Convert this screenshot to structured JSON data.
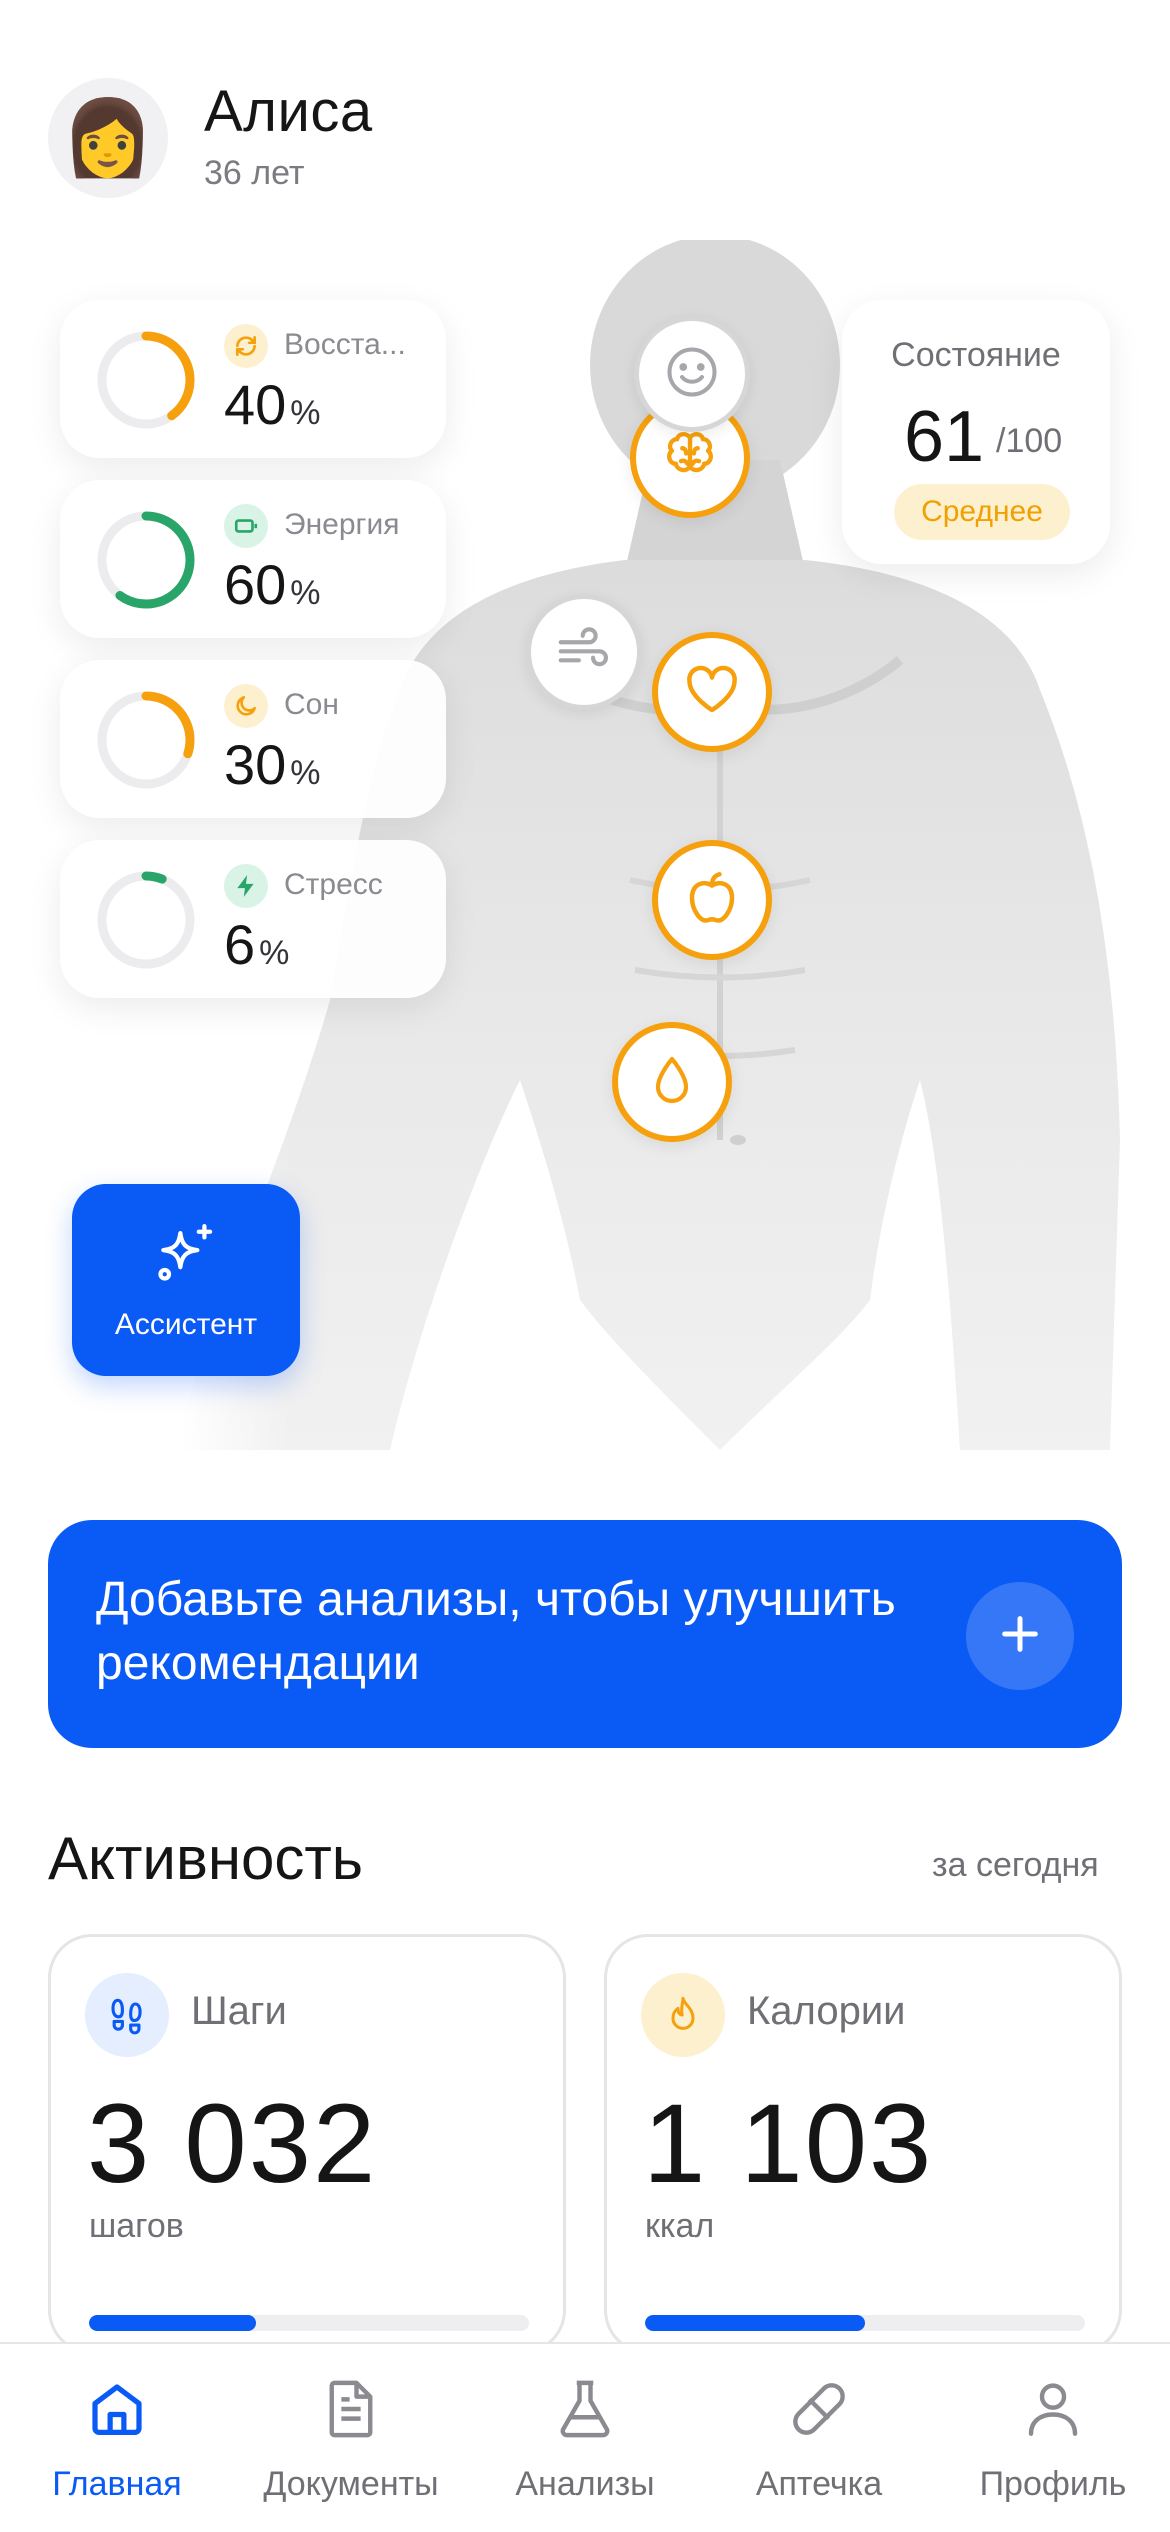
{
  "user": {
    "avatar_emoji": "👩",
    "name": "Алиса",
    "age": "36 лет"
  },
  "metrics": [
    {
      "label": "Восста...",
      "value": "40",
      "unit": "%",
      "progress": 0.4,
      "color": "#f5a00c",
      "icon": "refresh-icon"
    },
    {
      "label": "Энергия",
      "value": "60",
      "unit": "%",
      "progress": 0.6,
      "color": "#2aa56a",
      "icon": "battery-icon"
    },
    {
      "label": "Сон",
      "value": "30",
      "unit": "%",
      "progress": 0.3,
      "color": "#f5a00c",
      "icon": "moon-icon"
    },
    {
      "label": "Стресс",
      "value": "6",
      "unit": "%",
      "progress": 0.06,
      "color": "#2aa56a",
      "icon": "lightning-icon"
    }
  ],
  "state": {
    "title": "Состояние",
    "score": "61",
    "max": "/100",
    "level": "Среднее"
  },
  "body_markers": [
    "smile-icon",
    "brain-icon",
    "wind-icon",
    "heart-icon",
    "apple-icon",
    "drop-icon"
  ],
  "assistant": {
    "label": "Ассистент"
  },
  "banner": {
    "text": "Добавьте анализы, чтобы улучшить рекомендации"
  },
  "activity": {
    "title": "Активность",
    "period": "за сегодня",
    "cards": [
      {
        "label": "Шаги",
        "value": "3 032",
        "unit": "шагов",
        "progress": 0.38,
        "icon": "footsteps-icon"
      },
      {
        "label": "Калории",
        "value": "1 103",
        "unit": "ккал",
        "progress": 0.5,
        "icon": "flame-icon"
      }
    ]
  },
  "nav": [
    {
      "label": "Главная",
      "active": true,
      "icon": "home-icon"
    },
    {
      "label": "Документы",
      "active": false,
      "icon": "document-icon"
    },
    {
      "label": "Анализы",
      "active": false,
      "icon": "flask-icon"
    },
    {
      "label": "Аптечка",
      "active": false,
      "icon": "pill-icon"
    },
    {
      "label": "Профиль",
      "active": false,
      "icon": "profile-icon"
    }
  ],
  "colors": {
    "accent": "#0a5af6",
    "orange": "#f5a00c",
    "green": "#2aa56a"
  }
}
